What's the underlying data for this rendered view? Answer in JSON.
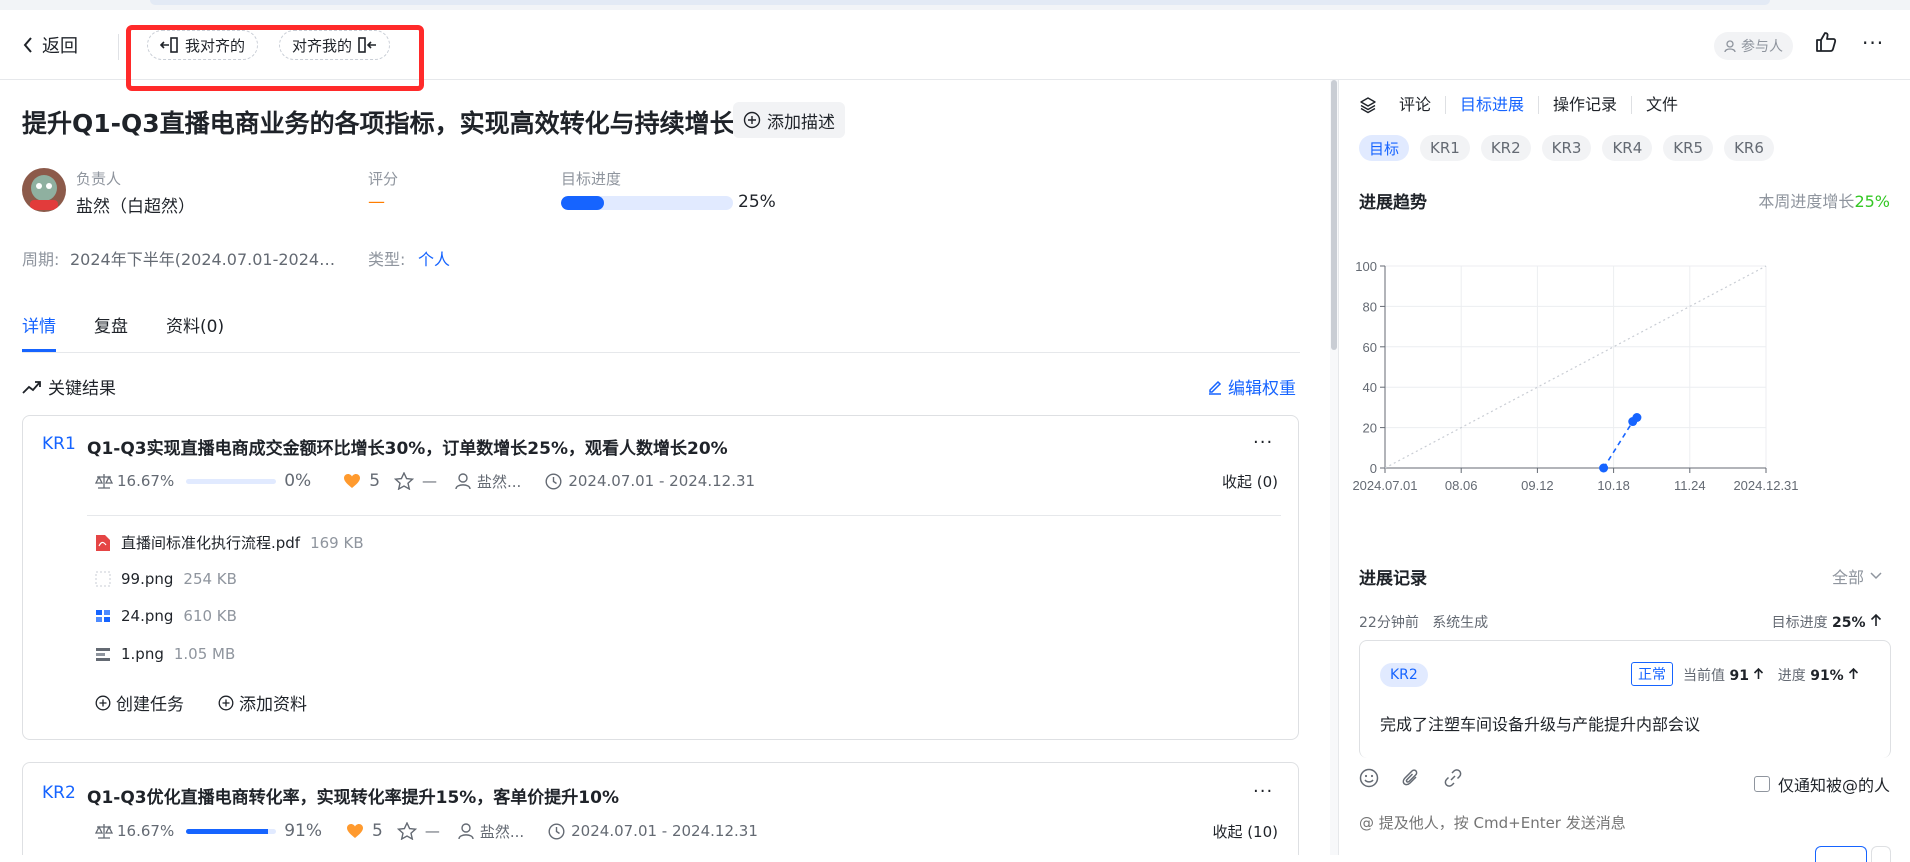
{
  "header": {
    "back_label": "返回",
    "align_mine_label": "我对齐的",
    "align_me_label": "对齐我的",
    "participants_label": "参与人"
  },
  "objective": {
    "title": "提升Q1-Q3直播电商业务的各项指标，实现高效转化与持续增长",
    "add_desc_label": "添加描述",
    "owner_label": "负责人",
    "owner_name": "盐然（白超然）",
    "score_label": "评分",
    "score_value": "—",
    "progress_label": "目标进度",
    "progress_value": "25%",
    "progress_fraction": 0.25,
    "period_label": "周期:",
    "period_value": "2024年下半年(2024.07.01-2024…",
    "type_label": "类型:",
    "type_value": "个人"
  },
  "tabs": [
    {
      "label": "详情",
      "active": true
    },
    {
      "label": "复盘",
      "active": false
    },
    {
      "label": "资料(0)",
      "active": false
    }
  ],
  "key_results": {
    "header_label": "关键结果",
    "edit_weight_label": "编辑权重",
    "items": [
      {
        "tag": "KR1",
        "title": "Q1-Q3实现直播电商成交金额环比增长30%，订单数增长25%，观看人数增长20%",
        "weight": "16.67%",
        "progress": "0%",
        "progress_fraction": 0.0,
        "likes": "5",
        "star_value": "—",
        "owner": "盐然...",
        "date_range": "2024.07.01 - 2024.12.31",
        "collapse_label": "收起 (0)",
        "files": [
          {
            "name": "直播间标准化执行流程.pdf",
            "size": "169 KB",
            "icon": "pdf-icon"
          },
          {
            "name": "99.png",
            "size": "254 KB",
            "icon": "image-icon"
          },
          {
            "name": "24.png",
            "size": "610 KB",
            "icon": "image-icon"
          },
          {
            "name": "1.png",
            "size": "1.05 MB",
            "icon": "image-icon"
          }
        ],
        "create_task_label": "创建任务",
        "add_material_label": "添加资料"
      },
      {
        "tag": "KR2",
        "title": "Q1-Q3优化直播电商转化率，实现转化率提升15%，客单价提升10%",
        "weight": "16.67%",
        "progress": "91%",
        "progress_fraction": 0.91,
        "likes": "5",
        "star_value": "—",
        "owner": "盐然...",
        "date_range": "2024.07.01 - 2024.12.31",
        "collapse_label": "收起 (10)"
      }
    ]
  },
  "right": {
    "tabs": [
      {
        "label": "评论",
        "active": false
      },
      {
        "label": "目标进展",
        "active": true
      },
      {
        "label": "操作记录",
        "active": false
      },
      {
        "label": "文件",
        "active": false
      }
    ],
    "chips": [
      {
        "label": "目标",
        "active": true
      },
      {
        "label": "KR1",
        "active": false
      },
      {
        "label": "KR2",
        "active": false
      },
      {
        "label": "KR3",
        "active": false
      },
      {
        "label": "KR4",
        "active": false
      },
      {
        "label": "KR5",
        "active": false
      },
      {
        "label": "KR6",
        "active": false
      }
    ],
    "trend_title": "进展趋势",
    "week_growth_label": "本周进度增长",
    "week_growth_value": "25%",
    "records_title": "进展记录",
    "filter_label": "全部",
    "record": {
      "time": "22分钟前",
      "source": "系统生成",
      "goal_progress_label": "目标进度",
      "goal_progress_value": "25%",
      "kr_tag": "KR2",
      "status": "正常",
      "current_label": "当前值",
      "current_value": "91",
      "progress_label": "进度",
      "progress_value": "91%",
      "text": "完成了注塑车间设备升级与产能提升内部会议"
    },
    "notify_label": "仅通知被@的人",
    "message_placeholder": "@ 提及他人，按 Cmd+Enter 发送消息"
  },
  "chart_data": {
    "type": "line",
    "x_ticks": [
      "2024.07.01",
      "08.06",
      "09.12",
      "10.18",
      "11.24",
      "2024.12.31"
    ],
    "y_ticks": [
      "0",
      "20",
      "40",
      "60",
      "80",
      "100"
    ],
    "ylim": [
      0,
      100
    ],
    "xlim": [
      "2024.07.01",
      "2024.12.31"
    ],
    "grid": true,
    "series": [
      {
        "role": "reference",
        "style": "dotted",
        "color": "#c9cdd4",
        "points": [
          {
            "x": "2024.07.01",
            "y": 0
          },
          {
            "x": "2024.12.31",
            "y": 100
          }
        ]
      },
      {
        "role": "actual",
        "style": "dashed",
        "color": "#1664ff",
        "points": [
          {
            "x": "2024.10.14",
            "y": 0
          },
          {
            "x": "2024.10.28",
            "y": 23
          },
          {
            "x": "2024.10.30",
            "y": 25
          }
        ]
      }
    ]
  }
}
